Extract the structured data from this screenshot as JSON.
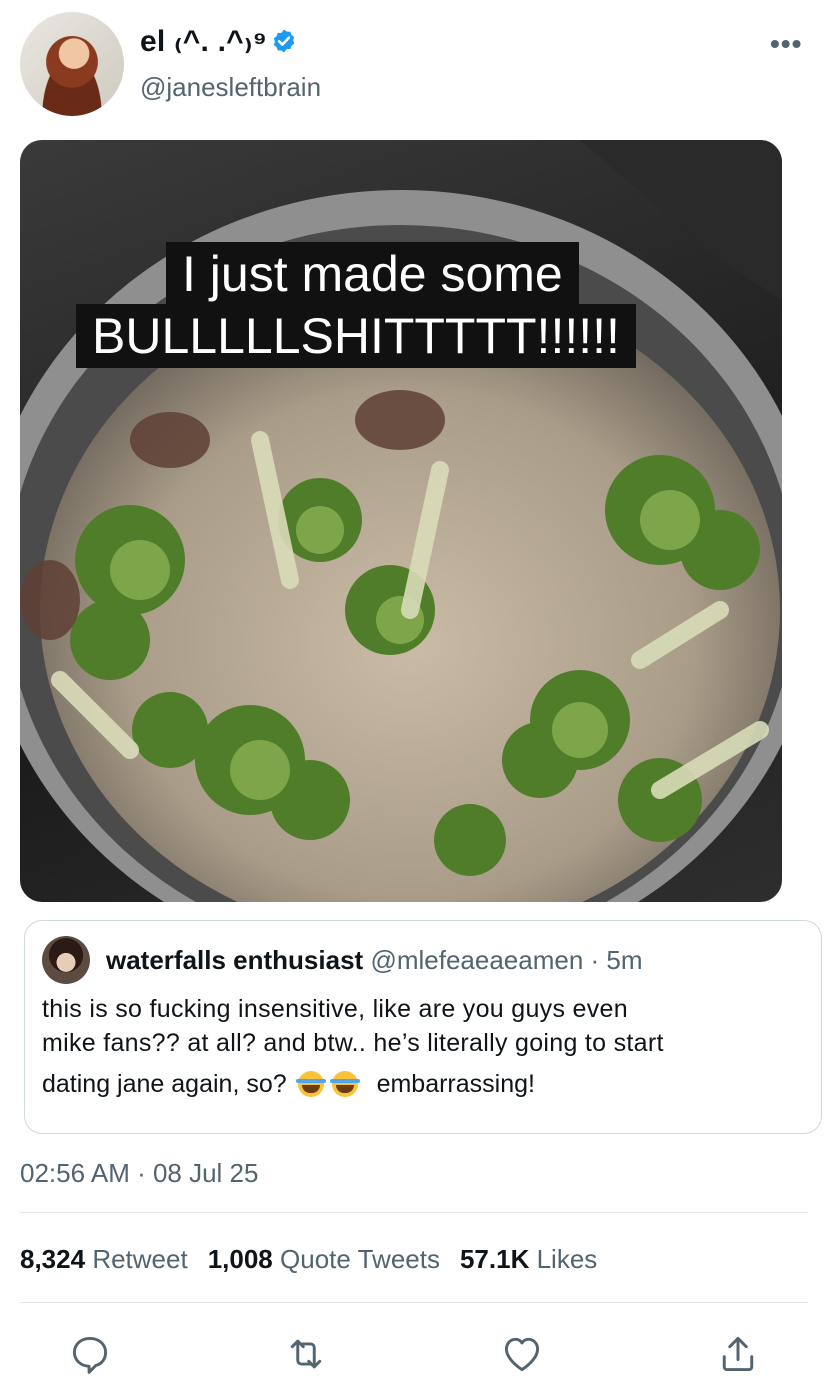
{
  "tweet": {
    "display_name": "el ₍^. .^₎⁹",
    "handle": "@janesleftbrain",
    "verified": true,
    "image_caption_line1": "I just made some",
    "image_caption_line2": "BULLLLLSHITTTTT!!!!!!",
    "timestamp": "02:56 AM · 08 Jul 25"
  },
  "quote": {
    "name": "waterfalls enthusiast",
    "handle": "@mlefeaeaeamen",
    "time": "· 5m",
    "text_line1": "this is so fucking insensitive, like are you guys even",
    "text_line2": "mike fans?? at all? and btw.. he’s literally going to start",
    "text_line3_start": "dating jane again, so?",
    "text_line3_end": "embarrassing!",
    "emoji_name": "face-with-tears-of-joy"
  },
  "stats": {
    "retweets_count": "8,324",
    "retweets_label": "Retweet",
    "quotes_count": "1,008",
    "quotes_label": "Quote Tweets",
    "likes_count": "57.1K",
    "likes_label": "Likes"
  },
  "icons": {
    "reply": "speech-bubble-icon",
    "retweet": "retweet-icon",
    "like": "heart-icon",
    "share": "share-icon",
    "more": "more-dots-icon",
    "verified": "verified-badge-icon"
  },
  "colors": {
    "verified_blue": "#1d9bf0",
    "secondary_text": "#536471",
    "primary_text": "#0f1419"
  }
}
